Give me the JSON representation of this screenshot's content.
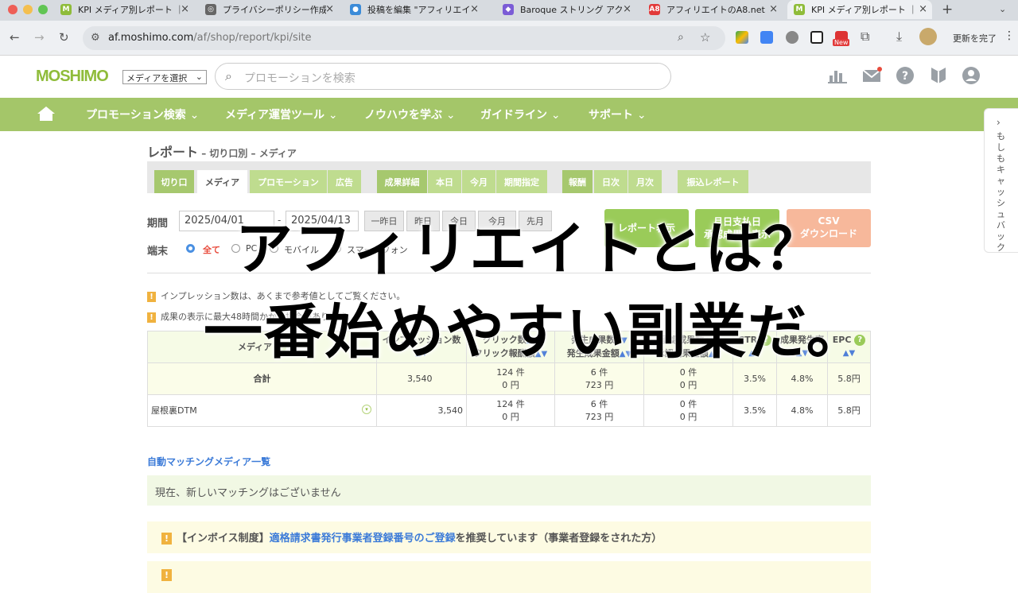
{
  "browser": {
    "tabs": [
      {
        "title": "KPI メディア別レポート ｜",
        "fav": "M",
        "color": "#8fbc3a"
      },
      {
        "title": "プライバシーポリシー作成",
        "fav": "◎",
        "color": "#666666"
      },
      {
        "title": "投稿を編集 \"アフィリエイト",
        "fav": "●",
        "color": "#3b8bd8"
      },
      {
        "title": "Baroque ストリング アクシ",
        "fav": "◆",
        "color": "#7b5cd6"
      },
      {
        "title": "アフィリエイトのA8.net",
        "fav": "A8",
        "color": "#e23a3a"
      },
      {
        "title": "KPI メディア別レポート ｜",
        "fav": "M",
        "color": "#8fbc3a"
      }
    ],
    "url_host": "af.moshimo.com",
    "url_path": "/af/shop/report/kpi/site",
    "update_label": "更新を完了",
    "new_badge": "New"
  },
  "header": {
    "logo": "MOSHIMO",
    "media_select": "メディアを選択",
    "search_placeholder": "プロモーションを検索"
  },
  "nav": [
    "プロモーション検索",
    "メディア運営ツール",
    "ノウハウを学ぶ",
    "ガイドライン",
    "サポート"
  ],
  "sidetab": "もしもキャッシュバック",
  "report": {
    "title": "レポート",
    "subtitle": " – 切り口別 – メディア",
    "tabs_group1": [
      "切り口",
      "メディア",
      "プロモーション",
      "広告"
    ],
    "tabs_group2": [
      "成果詳細",
      "本日",
      "今月",
      "期間指定"
    ],
    "tabs_group3": [
      "報酬",
      "日次",
      "月次"
    ],
    "tabs_group4": [
      "振込レポート"
    ],
    "period_label": "期間",
    "date_from": "2025/04/01",
    "date_to": "2025/04/13",
    "quick": [
      "一昨日",
      "昨日",
      "今日",
      "今月",
      "先月"
    ],
    "show_report": "レポート表示",
    "show_confirmed": "月日支払日\n承認成果を表示",
    "csv": "CSV\nダウンロード",
    "device_label": "端末",
    "devices": [
      "全て",
      "PC",
      "モバイル",
      "スマートフォン"
    ],
    "notice1": "インプレッション数は、あくまで参考値としてご覧ください。",
    "notice2": "成果の表示に最大48時間かかる場合があります。"
  },
  "table": {
    "headers": {
      "media": "メディア",
      "impressions": "インプレッション数",
      "clicks": "クリック数",
      "click_reward": "クリック報酬額",
      "occurred": "発生成果数",
      "occurred_amount": "発生成果金額",
      "approved": "承認成果数",
      "approved_amount": "承認成果金額",
      "ctr": "CTR",
      "rate": "成果発生率",
      "epc": "EPC"
    },
    "rows": [
      {
        "name": "合計",
        "imp": "3,540",
        "clicks": "124 件",
        "click_reward": "0 円",
        "occ": "6 件",
        "occ_amt": "723 円",
        "appr": "0 件",
        "appr_amt": "0 円",
        "ctr": "3.5%",
        "rate": "4.8%",
        "epc": "5.8円"
      },
      {
        "name": "屋根裏DTM",
        "imp": "3,540",
        "clicks": "124 件",
        "click_reward": "0 円",
        "occ": "6 件",
        "occ_amt": "723 円",
        "appr": "0 件",
        "appr_amt": "0 円",
        "ctr": "3.5%",
        "rate": "4.8%",
        "epc": "5.8円"
      }
    ]
  },
  "auto_matching": {
    "link": "自動マッチングメディア一覧",
    "message": "現在、新しいマッチングはございません"
  },
  "invoice": {
    "prefix": "【インボイス制度】",
    "link": "適格請求書発行事業者登録番号のご登録",
    "suffix": "を推奨しています（事業者登録をされた方）"
  },
  "overlay": {
    "line1": "アフィリエイトとは？",
    "line2": "一番始めやすい副業だ。"
  }
}
